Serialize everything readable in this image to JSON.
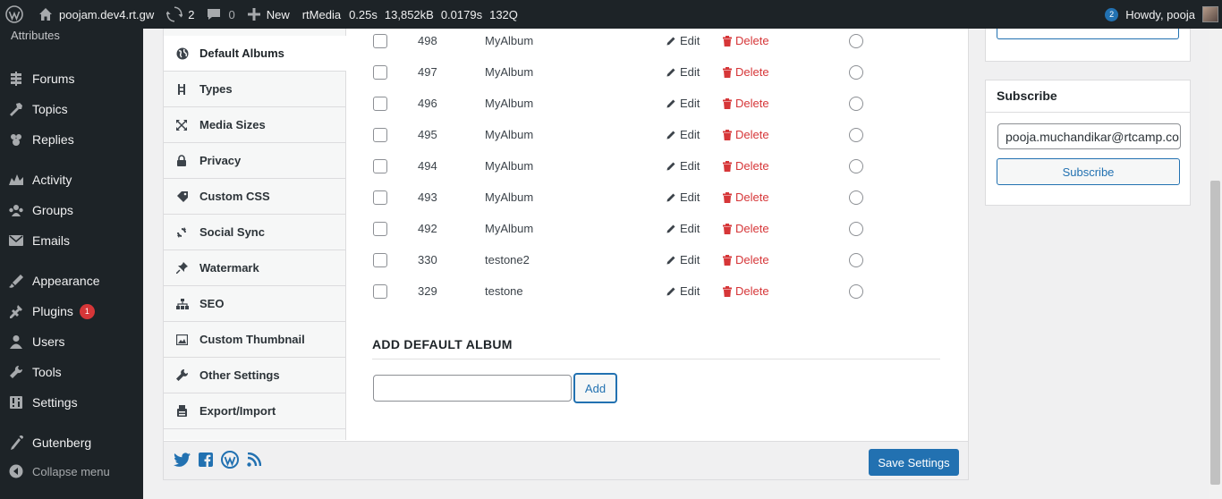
{
  "admin_bar": {
    "site_name": "poojam.dev4.rt.gw",
    "updates_count": "2",
    "comments_count": "0",
    "new_label": "New",
    "rtmedia_label": "rtMedia",
    "query_time": "0.25s",
    "memory": "13,852kB",
    "db_time": "0.0179s",
    "queries": "132Q",
    "notification_count": "2",
    "howdy": "Howdy, pooja"
  },
  "sidebar": {
    "top_partial": "Attributes",
    "items": [
      {
        "label": "Forums",
        "icon": "forums-icon"
      },
      {
        "label": "Topics",
        "icon": "topics-icon"
      },
      {
        "label": "Replies",
        "icon": "replies-icon"
      },
      {
        "label": "Activity",
        "icon": "activity-icon"
      },
      {
        "label": "Groups",
        "icon": "groups-icon"
      },
      {
        "label": "Emails",
        "icon": "emails-icon"
      },
      {
        "label": "Appearance",
        "icon": "appearance-icon"
      },
      {
        "label": "Plugins",
        "icon": "plugins-icon",
        "badge": "1"
      },
      {
        "label": "Users",
        "icon": "users-icon"
      },
      {
        "label": "Tools",
        "icon": "tools-icon"
      },
      {
        "label": "Settings",
        "icon": "settings-icon"
      },
      {
        "label": "Gutenberg",
        "icon": "gutenberg-icon"
      },
      {
        "label": "Collapse menu",
        "icon": "collapse-icon"
      }
    ]
  },
  "tabs": [
    {
      "label": "Default Albums",
      "icon": "globe-icon",
      "active": true
    },
    {
      "label": "Types",
      "icon": "types-icon"
    },
    {
      "label": "Media Sizes",
      "icon": "media-sizes-icon"
    },
    {
      "label": "Privacy",
      "icon": "lock-icon"
    },
    {
      "label": "Custom CSS",
      "icon": "tag-icon"
    },
    {
      "label": "Social Sync",
      "icon": "sync-icon"
    },
    {
      "label": "Watermark",
      "icon": "pin-icon"
    },
    {
      "label": "SEO",
      "icon": "sitemap-icon"
    },
    {
      "label": "Custom Thumbnail",
      "icon": "image-icon"
    },
    {
      "label": "Other Settings",
      "icon": "wrench-icon"
    },
    {
      "label": "Export/Import",
      "icon": "export-icon"
    }
  ],
  "albums": {
    "edit_label": "Edit",
    "delete_label": "Delete",
    "rows": [
      {
        "id": "498",
        "name": "MyAlbum"
      },
      {
        "id": "497",
        "name": "MyAlbum"
      },
      {
        "id": "496",
        "name": "MyAlbum"
      },
      {
        "id": "495",
        "name": "MyAlbum"
      },
      {
        "id": "494",
        "name": "MyAlbum"
      },
      {
        "id": "493",
        "name": "MyAlbum"
      },
      {
        "id": "492",
        "name": "MyAlbum"
      },
      {
        "id": "330",
        "name": "testone2"
      },
      {
        "id": "329",
        "name": "testone"
      }
    ]
  },
  "add_album": {
    "title": "ADD DEFAULT ALBUM",
    "input_value": "",
    "button_label": "Add"
  },
  "footer": {
    "social_icons": [
      "twitter-icon",
      "facebook-icon",
      "wordpress-icon",
      "rss-icon"
    ],
    "save_label": "Save Settings"
  },
  "subscribe_widget": {
    "title": "Subscribe",
    "email_value": "pooja.muchandikar@rtcamp.com",
    "button_label": "Subscribe"
  },
  "colors": {
    "admin_bg": "#1d2327",
    "primary": "#2271b1",
    "delete": "#d63638",
    "badge": "#d63638"
  }
}
